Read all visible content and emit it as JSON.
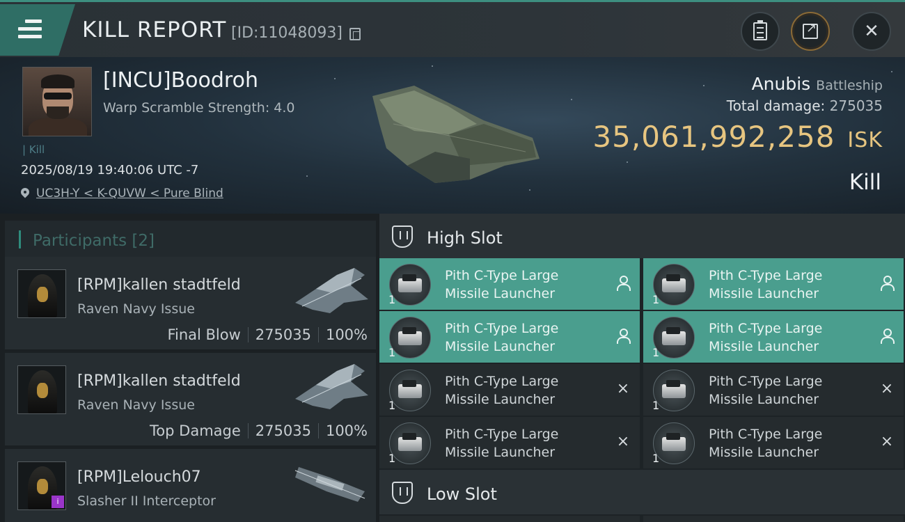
{
  "header": {
    "title": "KILL REPORT",
    "report_id": "[ID:11048093]"
  },
  "victim": {
    "name": "[INCU]Boodroh",
    "subtitle": "Warp Scramble Strength: 4.0",
    "kill_tag": "| Kill",
    "time": "2025/08/19 19:40:06 UTC -7",
    "location": "UC3H-Y < K-QUVW < Pure Blind",
    "ship": "Anubis",
    "ship_class": "Battleship",
    "total_damage_label": "Total damage:",
    "total_damage": "275035",
    "isk_value": "35,061,992,258",
    "isk_unit": "ISK",
    "result": "Kill"
  },
  "participants": {
    "header": "Participants [2]",
    "items": [
      {
        "name": "[RPM]kallen stadtfeld",
        "ship": "Raven Navy Issue",
        "role": "Final Blow",
        "damage": "275035",
        "percent": "100%"
      },
      {
        "name": "[RPM]kallen stadtfeld",
        "ship": "Raven Navy Issue",
        "role": "Top Damage",
        "damage": "275035",
        "percent": "100%"
      },
      {
        "name": "[RPM]Lelouch07",
        "ship": "Slasher II Interceptor"
      }
    ]
  },
  "slots": {
    "high_label": "High Slot",
    "low_label": "Low Slot",
    "modules": [
      {
        "line1": "Pith C-Type Large",
        "line2": "Missile Launcher",
        "qty": "1",
        "status": "dropped"
      },
      {
        "line1": "Pith C-Type Large",
        "line2": "Missile Launcher",
        "qty": "1",
        "status": "dropped"
      },
      {
        "line1": "Pith C-Type Large",
        "line2": "Missile Launcher",
        "qty": "1",
        "status": "dropped"
      },
      {
        "line1": "Pith C-Type Large",
        "line2": "Missile Launcher",
        "qty": "1",
        "status": "dropped"
      },
      {
        "line1": "Pith C-Type Large",
        "line2": "Missile Launcher",
        "qty": "1",
        "status": "destroyed",
        "mark": "×"
      },
      {
        "line1": "Pith C-Type Large",
        "line2": "Missile Launcher",
        "qty": "1",
        "status": "destroyed",
        "mark": "×"
      },
      {
        "line1": "Pith C-Type Large",
        "line2": "Missile Launcher",
        "qty": "1",
        "status": "destroyed",
        "mark": "×"
      },
      {
        "line1": "Pith C-Type Large",
        "line2": "Missile Launcher",
        "qty": "1",
        "status": "destroyed",
        "mark": "×"
      }
    ]
  },
  "colors": {
    "accent": "#2f8c7d",
    "dropped_bg": "#4a9e8e",
    "isk_gold": "#e7c580"
  },
  "icons": {
    "menu": "menu-icon",
    "copy": "copy-icon",
    "clipboard": "clipboard-icon",
    "share": "share-icon",
    "close": "close-icon",
    "location": "pin-icon",
    "slot": "shield-icon",
    "dropped": "person-icon",
    "destroyed": "x-icon"
  }
}
